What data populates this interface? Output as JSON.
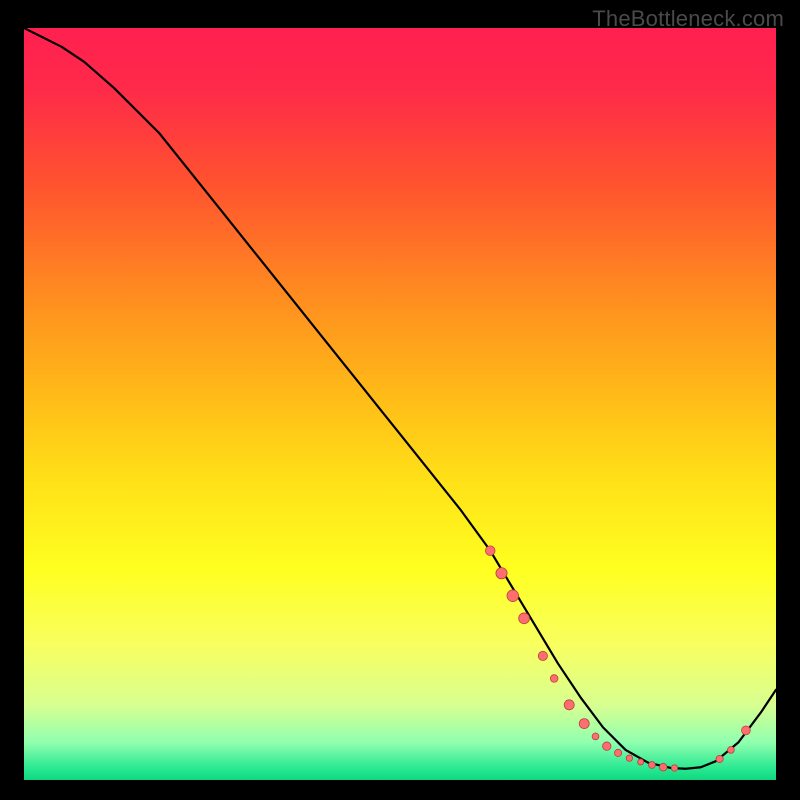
{
  "watermark": "TheBottleneck.com",
  "chart_data": {
    "type": "line",
    "title": "",
    "xlabel": "",
    "ylabel": "",
    "xlim": [
      0,
      100
    ],
    "ylim": [
      0,
      100
    ],
    "background_gradient_stops": [
      {
        "offset": 0.0,
        "color": "#ff2050"
      },
      {
        "offset": 0.08,
        "color": "#ff2a4a"
      },
      {
        "offset": 0.2,
        "color": "#ff5030"
      },
      {
        "offset": 0.35,
        "color": "#ff8a20"
      },
      {
        "offset": 0.48,
        "color": "#ffb818"
      },
      {
        "offset": 0.6,
        "color": "#ffe018"
      },
      {
        "offset": 0.72,
        "color": "#ffff20"
      },
      {
        "offset": 0.82,
        "color": "#f8ff60"
      },
      {
        "offset": 0.9,
        "color": "#d8ff90"
      },
      {
        "offset": 0.95,
        "color": "#90ffb0"
      },
      {
        "offset": 0.985,
        "color": "#28e890"
      },
      {
        "offset": 1.0,
        "color": "#10d880"
      }
    ],
    "series": [
      {
        "name": "curve",
        "color": "#000000",
        "stroke_width": 2.2,
        "x": [
          0.0,
          2.0,
          5.0,
          8.0,
          12.0,
          18.0,
          26.0,
          34.0,
          42.0,
          50.0,
          58.0,
          62.0,
          65.0,
          68.0,
          71.0,
          74.0,
          77.0,
          80.0,
          83.0,
          86.0,
          88.0,
          90.0,
          92.0,
          95.0,
          98.0,
          100.0
        ],
        "y": [
          100.0,
          99.0,
          97.5,
          95.5,
          92.0,
          86.0,
          76.0,
          66.0,
          56.0,
          46.0,
          36.0,
          30.5,
          25.5,
          20.5,
          15.5,
          11.0,
          7.0,
          4.0,
          2.3,
          1.6,
          1.5,
          1.7,
          2.5,
          5.0,
          9.0,
          12.0
        ]
      }
    ],
    "markers": {
      "color": "#ff6e6e",
      "stroke": "#b84040",
      "points": [
        {
          "x": 62.0,
          "y": 30.5,
          "r": 4.8
        },
        {
          "x": 63.5,
          "y": 27.5,
          "r": 5.6
        },
        {
          "x": 65.0,
          "y": 24.5,
          "r": 5.8
        },
        {
          "x": 66.5,
          "y": 21.5,
          "r": 5.4
        },
        {
          "x": 69.0,
          "y": 16.5,
          "r": 4.6
        },
        {
          "x": 70.5,
          "y": 13.5,
          "r": 3.8
        },
        {
          "x": 72.5,
          "y": 10.0,
          "r": 5.0
        },
        {
          "x": 74.5,
          "y": 7.5,
          "r": 5.0
        },
        {
          "x": 76.0,
          "y": 5.8,
          "r": 3.4
        },
        {
          "x": 77.5,
          "y": 4.5,
          "r": 4.2
        },
        {
          "x": 79.0,
          "y": 3.6,
          "r": 3.6
        },
        {
          "x": 80.5,
          "y": 2.9,
          "r": 3.2
        },
        {
          "x": 82.0,
          "y": 2.4,
          "r": 3.0
        },
        {
          "x": 83.5,
          "y": 2.0,
          "r": 3.4
        },
        {
          "x": 85.0,
          "y": 1.7,
          "r": 3.8
        },
        {
          "x": 86.5,
          "y": 1.6,
          "r": 3.2
        },
        {
          "x": 92.5,
          "y": 2.8,
          "r": 3.6
        },
        {
          "x": 94.0,
          "y": 4.0,
          "r": 3.4
        },
        {
          "x": 96.0,
          "y": 6.6,
          "r": 4.4
        }
      ]
    }
  }
}
